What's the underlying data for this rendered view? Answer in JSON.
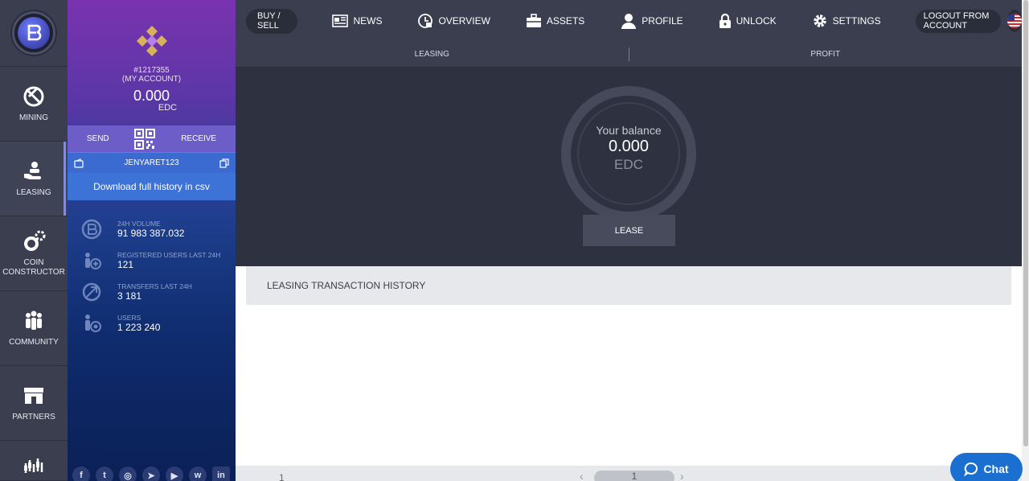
{
  "nav": {
    "items": [
      {
        "label": "MINING",
        "icon": "mining-icon"
      },
      {
        "label": "LEASING",
        "icon": "leasing-icon"
      },
      {
        "label": "COIN\nCONSTRUCTOR",
        "icon": "coin-constructor-icon"
      },
      {
        "label": "COMMUNITY",
        "icon": "community-icon"
      },
      {
        "label": "PARTNERS",
        "icon": "partners-icon"
      }
    ]
  },
  "account": {
    "id": "#1217355",
    "my_account": "(MY ACCOUNT)",
    "balance": "0.000",
    "currency": "EDC",
    "send_label": "SEND",
    "receive_label": "RECEIVE",
    "username": "JENYARET123",
    "download_label": "Download full history in csv"
  },
  "stats": [
    {
      "label": "24H VOLUME",
      "value": "91 983 387.032"
    },
    {
      "label": "REGISTERED USERS LAST 24H",
      "value": "121"
    },
    {
      "label": "TRANSFERS LAST 24H",
      "value": "3 181"
    },
    {
      "label": "USERS",
      "value": "1 223 240"
    }
  ],
  "topnav": {
    "buy_sell": "BUY / SELL",
    "news": "NEWS",
    "overview": "OVERVIEW",
    "assets": "ASSETS",
    "profile": "PROFILE",
    "unlock": "UNLOCK",
    "settings": "SETTINGS",
    "logout": "LOGOUT FROM ACCOUNT"
  },
  "subnav": {
    "leasing": "LEASING",
    "profit": "PROFIT"
  },
  "balance": {
    "label": "Your balance",
    "value": "0.000",
    "currency": "EDC",
    "lease_button": "LEASE"
  },
  "history": {
    "title": "LEASING TRANSACTION HISTORY",
    "page_left": "1",
    "page_current": "1"
  },
  "chat": {
    "label": "Chat"
  }
}
